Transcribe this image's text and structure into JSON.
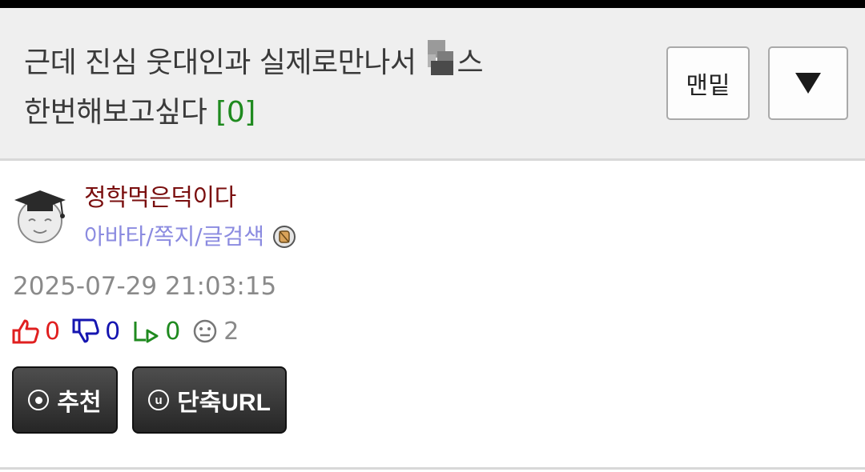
{
  "post": {
    "title_part1": "근데 진심 웃대인과 실제로만나서 ",
    "title_part2": "스",
    "title_line2": "한번해보고싶다 ",
    "comment_count": "[0]"
  },
  "header_buttons": {
    "bottom_label": "맨밑",
    "down_icon": "triangle-down-icon"
  },
  "author": {
    "name": "정학먹은덕이다",
    "links": "아바타/쪽지/글검색",
    "avatar_icon": "graduate-face-icon",
    "badge_icon": "level-badge-icon"
  },
  "meta": {
    "date": "2025-07-29 21:03:15"
  },
  "stats": {
    "upvotes": "0",
    "downvotes": "0",
    "shares": "0",
    "views": "2"
  },
  "actions": {
    "recommend_label": "추천",
    "shorturl_label": "단축URL",
    "shorturl_icon_letter": "u"
  },
  "colors": {
    "author_name": "#7a0f0f",
    "author_links": "#8b8be0",
    "upvote": "#e01f1f",
    "downvote": "#1515b0",
    "share": "#1f8a1f",
    "comment_count": "#1f8a1f"
  }
}
